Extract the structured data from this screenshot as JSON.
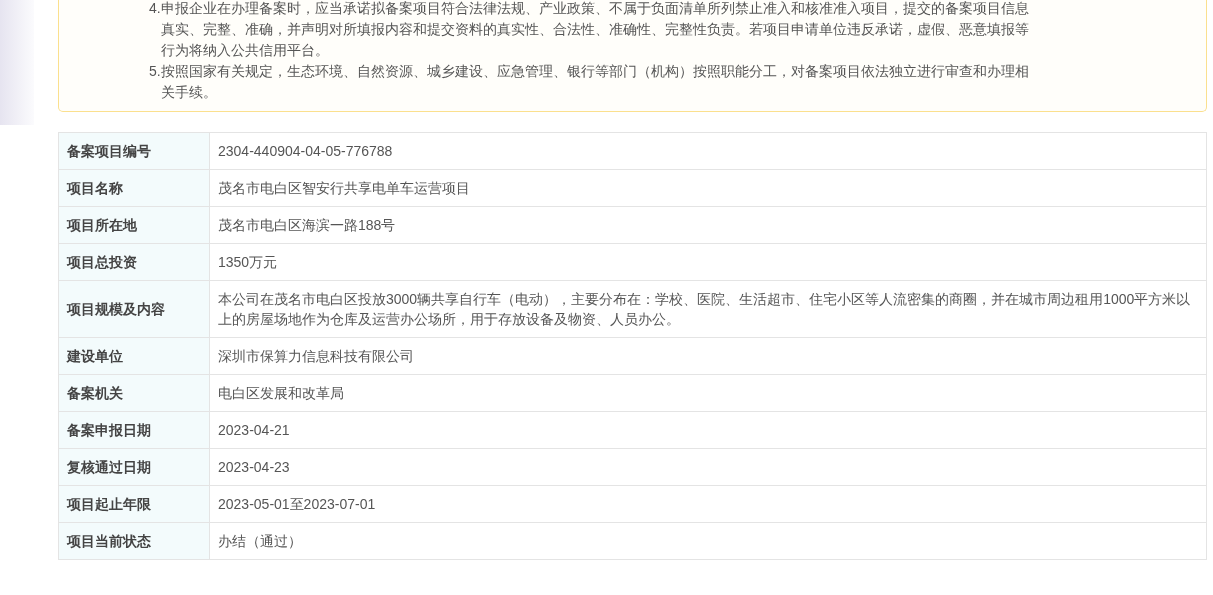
{
  "notice": {
    "items": [
      "4.申报企业在办理备案时，应当承诺拟备案项目符合法律法规、产业政策、不属于负面清单所列禁止准入和核准准入项目，提交的备案项目信息真实、完整、准确，并声明对所填报内容和提交资料的真实性、合法性、准确性、完整性负责。若项目申请单位违反承诺，虚假、恶意填报等行为将纳入公共信用平台。",
      "5.按照国家有关规定，生态环境、自然资源、城乡建设、应急管理、银行等部门（机构）按照职能分工，对备案项目依法独立进行审查和办理相关手续。"
    ]
  },
  "details": [
    {
      "label": "备案项目编号",
      "value": "2304-440904-04-05-776788"
    },
    {
      "label": "项目名称",
      "value": "茂名市电白区智安行共享电单车运营项目"
    },
    {
      "label": "项目所在地",
      "value": "茂名市电白区海滨一路188号"
    },
    {
      "label": "项目总投资",
      "value": "1350万元"
    },
    {
      "label": "项目规模及内容",
      "value": "本公司在茂名市电白区投放3000辆共享自行车（电动），主要分布在：学校、医院、生活超市、住宅小区等人流密集的商圈，并在城市周边租用1000平方米以上的房屋场地作为仓库及运营办公场所，用于存放设备及物资、人员办公。"
    },
    {
      "label": "建设单位",
      "value": "深圳市保算力信息科技有限公司"
    },
    {
      "label": "备案机关",
      "value": "电白区发展和改革局"
    },
    {
      "label": "备案申报日期",
      "value": "2023-04-21"
    },
    {
      "label": "复核通过日期",
      "value": "2023-04-23"
    },
    {
      "label": "项目起止年限",
      "value": "2023-05-01至2023-07-01"
    },
    {
      "label": "项目当前状态",
      "value": "办结（通过）"
    }
  ]
}
